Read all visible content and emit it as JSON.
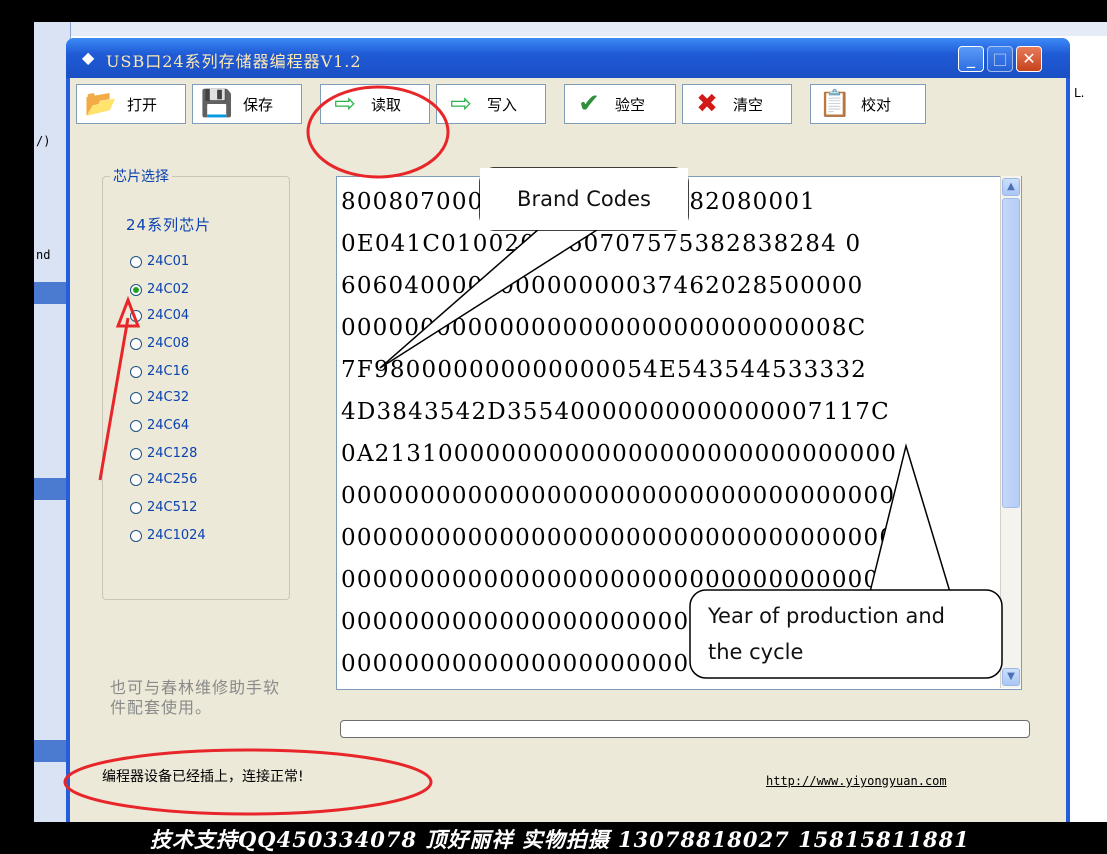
{
  "background": {
    "left_strip_text": [
      "/)",
      "nd"
    ],
    "right_edge_text": "L."
  },
  "window": {
    "title": "USB口24系列存储器编程器V1.2",
    "controls": {
      "minimize": "_",
      "maximize": "□",
      "close": "✕"
    }
  },
  "toolbar": {
    "open": "打开",
    "save": "保存",
    "read": "读取",
    "write": "写入",
    "verify_blank": "验空",
    "clear": "清空",
    "compare": "校对"
  },
  "chip_panel": {
    "group_label": "芯片选择",
    "series_title": "24系列芯片",
    "chips": [
      "24C01",
      "24C02",
      "24C04",
      "24C08",
      "24C16",
      "24C32",
      "24C64",
      "24C128",
      "24C256",
      "24C512",
      "24C1024"
    ],
    "selected": "24C02",
    "hint": "也可与春林维修助手软件配套使用。"
  },
  "hex_dump": {
    "lines": [
      "800807000000000450650082080001",
      "0E041C0100200060707575382838284 0",
      "606040000000000000037462028500000",
      "00000000000000000000000000000008C",
      "7F980000000000000054E543544533332",
      "4D3843542D35540000000000000007117C",
      "0A213100000000000000000000000000000",
      "000000000000000000000000000000000000",
      "000000000000000000000000000000000000",
      "000000000000000000000000000000000000",
      "000000000000000000000000000000000000",
      "0000000000000000000000000000000000000"
    ]
  },
  "status": {
    "message": "编程器设备已经插上，连接正常!",
    "url": "http://www.yiyongyuan.com"
  },
  "annotations": {
    "brand_codes": "Brand Codes",
    "year_of_production": "Year of production and the cycle"
  },
  "caption": "技术支持QQ450334078  顶好丽祥  实物拍摄  13078818027 15815811881",
  "colors": {
    "titlebar": "#1f5bd6",
    "annotation_red": "#e8262a",
    "selected_radio": "#21a121",
    "label_blue": "#0a42b0"
  }
}
